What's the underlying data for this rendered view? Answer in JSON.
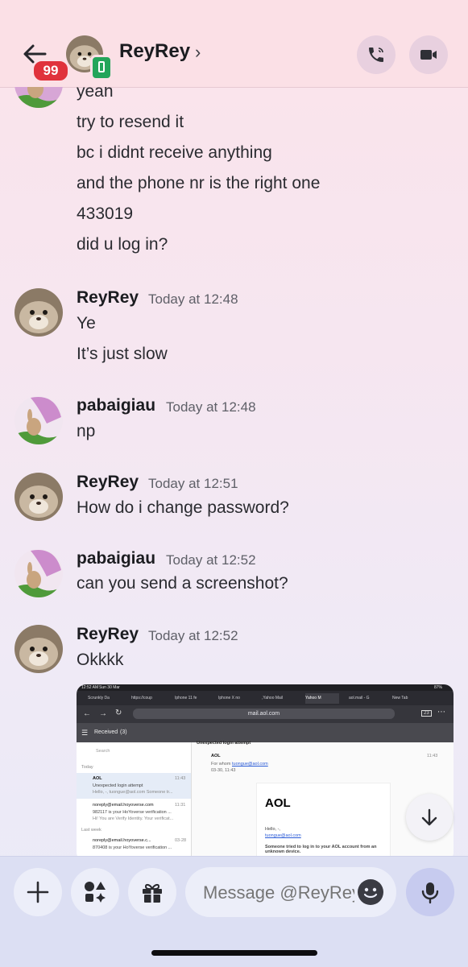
{
  "header": {
    "title": "ReyRey",
    "unread_badge": "99",
    "chevron": "›"
  },
  "messages": {
    "continuation_lines": [
      "yeah",
      "try to resend it",
      "bc i didnt receive anything",
      "and the phone nr is the right one",
      "433019",
      "did u log in?"
    ],
    "groups": [
      {
        "author": "ReyRey",
        "time": "Today at 12:48",
        "lines": [
          "Ye",
          "It’s just slow"
        ]
      },
      {
        "author": "pabaigiau",
        "time": "Today at 12:48",
        "lines": [
          "np"
        ]
      },
      {
        "author": "ReyRey",
        "time": "Today at 12:51",
        "lines": [
          "How do i change password?"
        ]
      },
      {
        "author": "pabaigiau",
        "time": "Today at 12:52",
        "lines": [
          "can you send a screenshot?"
        ]
      },
      {
        "author": "ReyRey",
        "time": "Today at 12:52",
        "lines": [
          "Okkkk"
        ]
      }
    ]
  },
  "attachment": {
    "status_time": "12:52 AM",
    "status_date": "Sun 30 Mar",
    "status_battery": "87%",
    "tabs": [
      "Scrunkly Da",
      "https://coup",
      "Iphone 11 fe",
      "Iphone X no",
      ",Yahoo Mail",
      "Yahoo M",
      "aol.mail - G",
      "New Tab"
    ],
    "url": "mail.aol.com",
    "tab_count": "23",
    "folder": "Received",
    "folder_count": "(3)",
    "search_placeholder": "Search",
    "section_today": "Today",
    "section_last_week": "Last week",
    "mails": [
      {
        "from": "AOL",
        "time": "11:43",
        "subject": "Unexpected login attempt",
        "preview": "Hello, -, tuongue@aol.com Someone tr..."
      },
      {
        "from": "noreply@email.hoyoverse.com",
        "time": "11:31",
        "subject": "982117 is your HoYoverse verification ...",
        "preview": "Hi! You are Verify Identity. Your verificat..."
      },
      {
        "from": "noreply@email.hoyoverse.c...",
        "time": "03-28",
        "subject": "870408 is your HoYoverse verification ...",
        "preview": ""
      }
    ],
    "reader": {
      "subject": "Unexpected login attempt",
      "from": "AOL",
      "for_label": "For whom",
      "for_email": "tuongue@aol.com",
      "date": "03-30, 11:43",
      "time": "11:43",
      "logo": "AOL",
      "greeting": "Hello, -,",
      "email": "tuongue@aol.com",
      "body": "Someone tried to log in to your AOL account from an unknown device."
    }
  },
  "composer": {
    "placeholder": "Message @ReyRey"
  },
  "colors": {
    "header_bg": "#fbe0e6",
    "badge": "#e0323c",
    "online_phone": "#23a55a",
    "composer_bg": "#dcdff3",
    "mic_bg": "#c7cbef"
  }
}
